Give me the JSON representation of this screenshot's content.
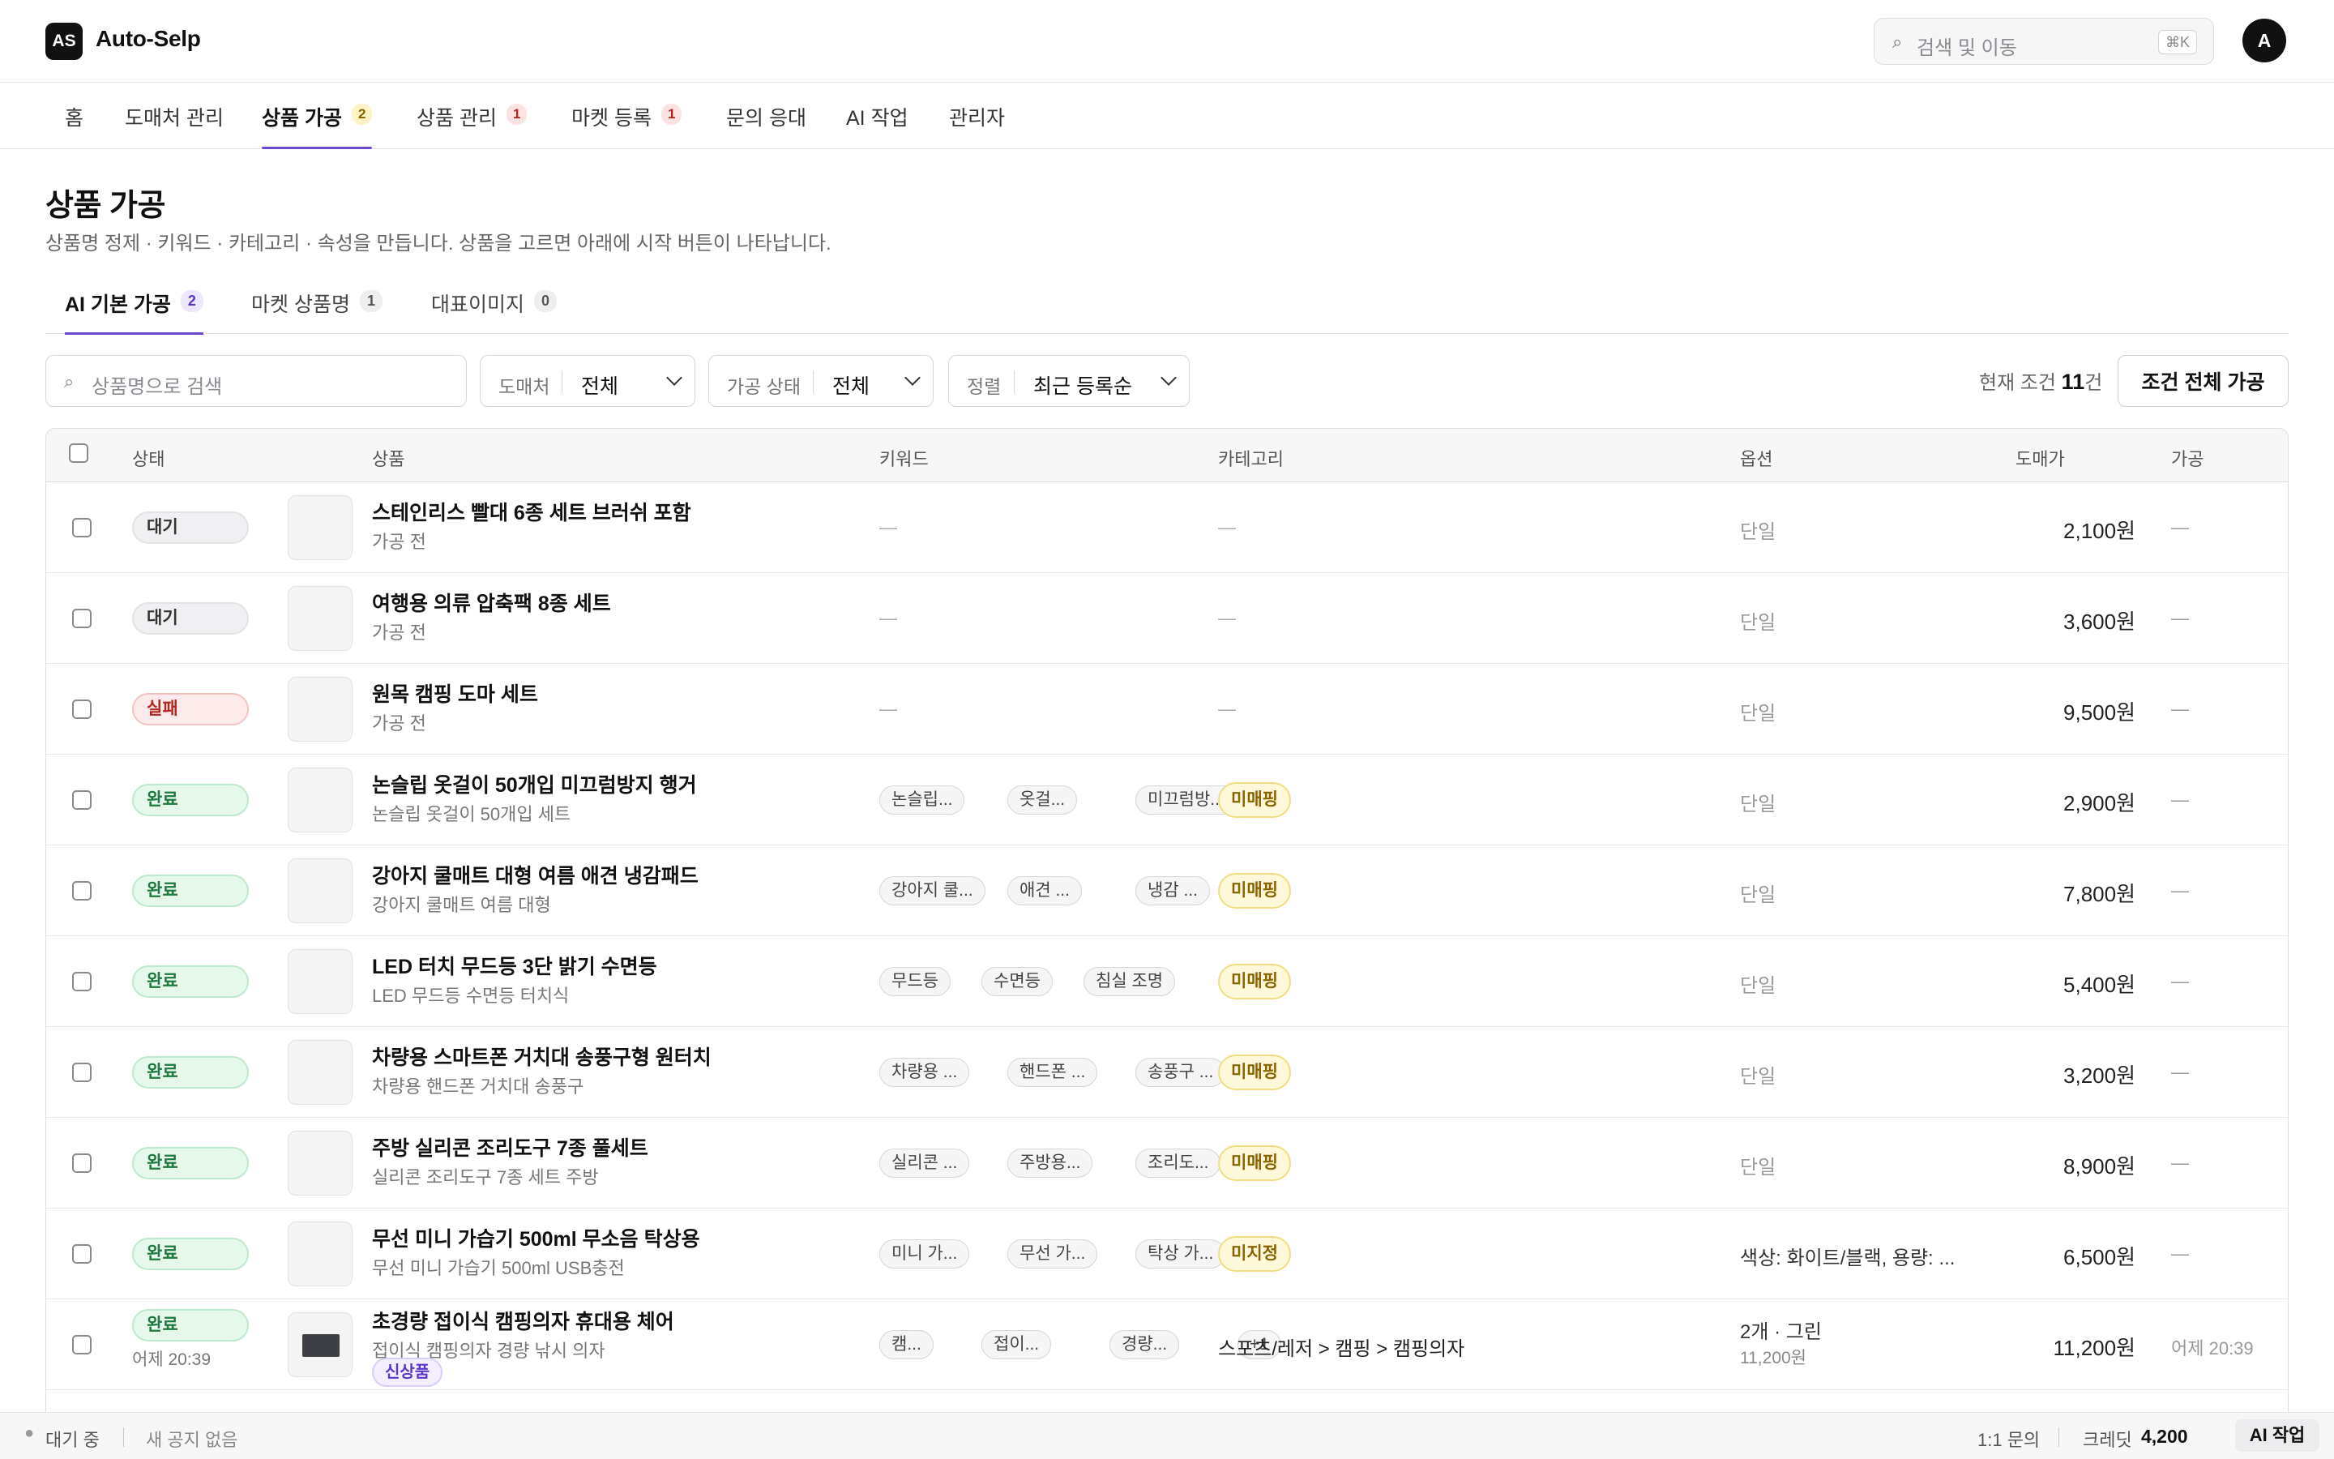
{
  "app": {
    "logo": "AS",
    "name": "Auto-Selp",
    "avatar": "A"
  },
  "search": {
    "icon": "search-icon",
    "placeholder": "검색 및 이동",
    "shortcut": "⌘K"
  },
  "nav": [
    {
      "label": "홈"
    },
    {
      "label": "도매처 관리"
    },
    {
      "label": "상품 가공",
      "badge": "2",
      "active": true
    },
    {
      "label": "상품 관리",
      "badge": "1"
    },
    {
      "label": "마켓 등록",
      "badge": "1"
    },
    {
      "label": "문의 응대"
    },
    {
      "label": "AI 작업"
    },
    {
      "label": "관리자"
    }
  ],
  "page": {
    "title": "상품 가공",
    "subtitle": "상품명 정제 · 키워드 · 카테고리 · 속성을 만듭니다. 상품을 고르면 아래에 시작 버튼이 나타납니다."
  },
  "subtabs": [
    {
      "label": "AI 기본 가공",
      "count": "2",
      "active": true
    },
    {
      "label": "마켓 상품명",
      "count": "1"
    },
    {
      "label": "대표이미지",
      "count": "0"
    }
  ],
  "filters": {
    "search_placeholder": "상품명으로 검색",
    "supplier": {
      "label": "도매처",
      "value": "전체"
    },
    "process_status": {
      "label": "가공 상태",
      "value": "전체"
    },
    "sort": {
      "label": "정렬",
      "value": "최근 등록순"
    },
    "count_prefix": "현재 조건",
    "count_value": "11",
    "count_suffix": "건",
    "bulk_button": "조건 전체 가공"
  },
  "table": {
    "headers": {
      "status": "상태",
      "product": "상품",
      "keywords": "키워드",
      "category": "카테고리",
      "options": "옵션",
      "price": "도매가",
      "processed": "가공"
    },
    "rows": [
      {
        "status": "대기",
        "name": "스테인리스 빨대 6종 세트 브러쉬 포함",
        "sub": "가공 전",
        "keywords": [],
        "category": "—",
        "option": "단일",
        "price": "2,100원",
        "processed": "—"
      },
      {
        "status": "대기",
        "name": "여행용 의류 압축팩 8종 세트",
        "sub": "가공 전",
        "keywords": [],
        "category": "—",
        "option": "단일",
        "price": "3,600원",
        "processed": "—"
      },
      {
        "status": "실패",
        "name": "원목 캠핑 도마 세트",
        "sub": "가공 전",
        "keywords": [],
        "category": "—",
        "option": "단일",
        "price": "9,500원",
        "processed": "—"
      },
      {
        "status": "완료",
        "name": "논슬립 옷걸이 50개입 미끄럼방지 행거",
        "sub": "논슬립 옷걸이 50개입 세트",
        "keywords": [
          "논슬립...",
          "옷걸...",
          "미끄럼방..."
        ],
        "category": "미매핑",
        "option": "단일",
        "price": "2,900원",
        "processed": "—"
      },
      {
        "status": "완료",
        "name": "강아지 쿨매트 대형 여름 애견 냉감패드",
        "sub": "강아지 쿨매트 여름 대형",
        "keywords": [
          "강아지 쿨...",
          "애견 ...",
          "냉감 ..."
        ],
        "category": "미매핑",
        "option": "단일",
        "price": "7,800원",
        "processed": "—"
      },
      {
        "status": "완료",
        "name": "LED 터치 무드등 3단 밝기 수면등",
        "sub": "LED 무드등 수면등 터치식",
        "keywords": [
          "무드등",
          "수면등",
          "침실 조명"
        ],
        "category": "미매핑",
        "option": "단일",
        "price": "5,400원",
        "processed": "—"
      },
      {
        "status": "완료",
        "name": "차량용 스마트폰 거치대 송풍구형 원터치",
        "sub": "차량용 핸드폰 거치대 송풍구",
        "keywords": [
          "차량용 ...",
          "핸드폰 ...",
          "송풍구 ..."
        ],
        "category": "미매핑",
        "option": "단일",
        "price": "3,200원",
        "processed": "—"
      },
      {
        "status": "완료",
        "name": "주방 실리콘 조리도구 7종 풀세트",
        "sub": "실리콘 조리도구 7종 세트 주방",
        "keywords": [
          "실리콘 ...",
          "주방용...",
          "조리도..."
        ],
        "category": "미매핑",
        "option": "단일",
        "price": "8,900원",
        "processed": "—"
      },
      {
        "status": "완료",
        "name": "무선 미니 가습기 500ml 무소음 탁상용",
        "sub": "무선 미니 가습기 500ml USB충전",
        "keywords": [
          "미니 가...",
          "무선 가...",
          "탁상 가..."
        ],
        "category": "미지정",
        "option": "색상: 화이트/블랙, 용량: ...",
        "price": "6,500원",
        "processed": "—"
      },
      {
        "status": "완료",
        "status_time": "어제 20:39",
        "name": "초경량 접이식 캠핑의자 휴대용 체어",
        "sub": "접이식 캠핑의자 경량 낚시 의자",
        "tag": "신상품",
        "keywords": [
          "캠...",
          "접이...",
          "경량...",
          "+1"
        ],
        "category": "스포츠/레저 > 캠핑 > 캠핑의자",
        "option": "2개 · 그린",
        "option_sub": "11,200원",
        "price": "11,200원",
        "processed": "어제 20:39"
      }
    ]
  },
  "footer": {
    "status": "대기 중",
    "notice": "새 공지 없음",
    "inquiry": "1:1 문의",
    "credit_label": "크레딧",
    "credit_value": "4,200",
    "ai_button": "AI 작업"
  },
  "colors": {
    "accent": "#6d4ad1",
    "done": "#1e7a3c",
    "fail": "#b3261e",
    "warn": "#8a6200"
  }
}
